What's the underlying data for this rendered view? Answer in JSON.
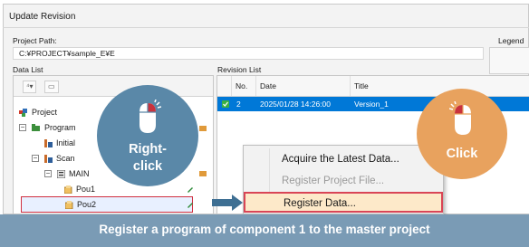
{
  "window": {
    "title": "Update Revision"
  },
  "project": {
    "path_label": "Project Path:",
    "path_value": "C:¥PROJECT¥sample_E¥E",
    "legend_label": "Legend"
  },
  "data_list": {
    "label": "Data List",
    "toolbar": {
      "btn1": "⁴▾",
      "btn2": "▭"
    },
    "tree": [
      {
        "label": "Project",
        "icon": "project-icon"
      },
      {
        "label": "Program",
        "icon": "program-folder-icon",
        "toggle": "−"
      },
      {
        "label": "Initial",
        "icon": "task-icon"
      },
      {
        "label": "Scan",
        "icon": "task-icon",
        "toggle": "−"
      },
      {
        "label": "MAIN",
        "icon": "program-icon",
        "toggle": "−"
      },
      {
        "label": "Pou1",
        "icon": "pou-icon"
      },
      {
        "label": "Pou2",
        "icon": "pou-icon",
        "selected": true
      }
    ]
  },
  "revision_list": {
    "label": "Revision List",
    "columns": [
      "No.",
      "Date",
      "Title"
    ],
    "rows": [
      {
        "no": "2",
        "date": "2025/01/28 14:26:00",
        "title": "Version_1"
      }
    ]
  },
  "context_menu": {
    "items": [
      {
        "label": "Acquire the Latest Data...",
        "disabled": false
      },
      {
        "label": "Register Project File...",
        "disabled": true
      },
      {
        "label": "Register Data...",
        "highlighted": true
      }
    ]
  },
  "callouts": {
    "left": {
      "line1": "Right-",
      "line2": "click"
    },
    "right": {
      "text": "Click"
    }
  },
  "banner": {
    "text": "Register a program of component 1 to the master project"
  },
  "colors": {
    "selection": "#0078d7",
    "highlight_border": "#d94556",
    "left_bubble": "#5a88a8",
    "right_bubble": "#e8a25e",
    "banner": "#7a9bb5"
  }
}
